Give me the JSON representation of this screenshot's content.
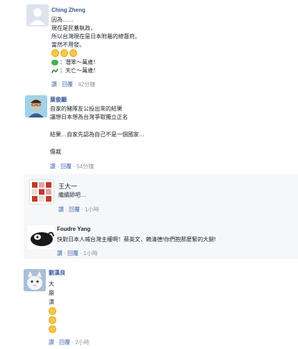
{
  "comments": [
    {
      "name": "Ching Zheng",
      "lines": [
        "因為……",
        "現在是民蓋執政，",
        "所以台灣現在是日本附屬的總督府。",
        "當然不用發。"
      ],
      "emoji_line": "",
      "frog_line": "：潛笨～萬歲！",
      "snake_line": "：天亡～萬歲！",
      "meta": {
        "like": "讚",
        "reply": "回覆",
        "time": "42分鐘"
      }
    },
    {
      "name": "葉俊顯",
      "lines": [
        "自家的豬隊友公投出來的結果",
        "讓想日本想為台灣爭取獨立正名",
        "",
        "結果…自家先認為自己不是一個國家…",
        "",
        "傷裁"
      ],
      "meta": {
        "like": "讚",
        "reply": "回覆",
        "time": "54分鐘"
      }
    },
    {
      "name": "王大一",
      "lines": [
        "繼續舔吧…"
      ],
      "meta": {
        "like": "讚",
        "reply": "回覆",
        "time": "1小時"
      }
    },
    {
      "name": "Foudre Yang",
      "lines": [
        "快對日本人喊台灣主權啊！蔡英文，賴清德!你們抱那麼緊的大腿!"
      ],
      "meta": {
        "like": "讚",
        "reply": "回覆",
        "time": "1小時"
      }
    },
    {
      "name": "劉漢良",
      "lines": [
        "大",
        "崩",
        "潰"
      ],
      "meta": {
        "like": "讚",
        "reply": "回覆",
        "time": "2小時"
      }
    }
  ],
  "colors": {
    "link": "#365899",
    "meta": "#90949c",
    "action": "#4267b2"
  }
}
